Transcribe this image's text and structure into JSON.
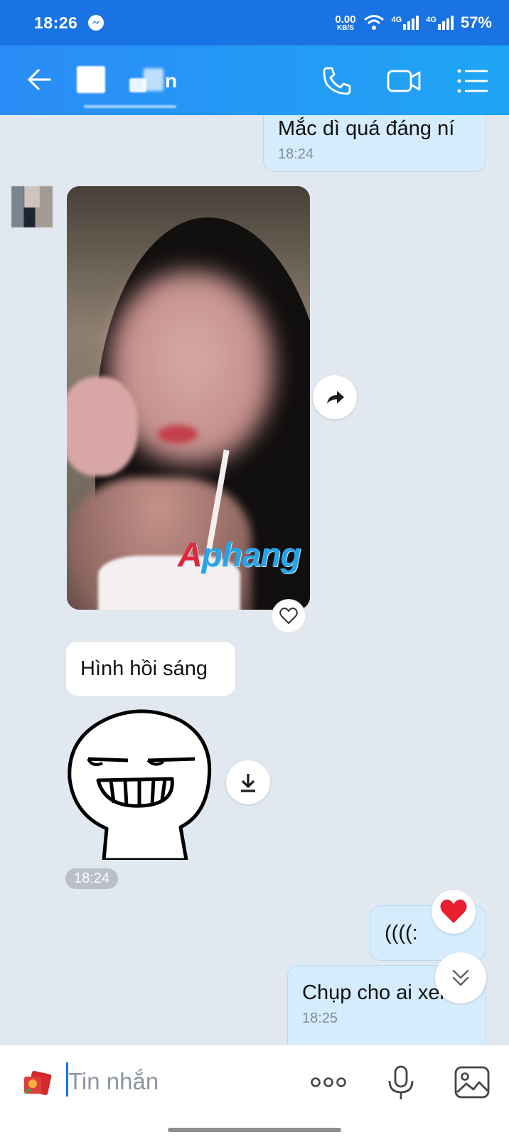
{
  "status_bar": {
    "time": "18:26",
    "net_speed_value": "0.00",
    "net_speed_unit": "KB/S",
    "network1": "4G",
    "network2": "4G",
    "battery": "57%"
  },
  "header": {
    "contact_name_visible": "n",
    "icons": [
      "back-arrow-icon",
      "phone-icon",
      "video-camera-icon",
      "menu-list-icon"
    ]
  },
  "messages": [
    {
      "side": "out",
      "text": "Mắc dì quá đáng ní",
      "time": "18:24"
    },
    {
      "side": "in",
      "type": "photo",
      "watermark_prefix": "A",
      "watermark": "phang"
    },
    {
      "side": "in",
      "text": "Hình hồi sáng"
    },
    {
      "side": "in",
      "type": "sticker"
    },
    {
      "side": "in",
      "type": "time-pill",
      "time": "18:24"
    },
    {
      "side": "out",
      "text": "((((:",
      "reaction": "heart"
    },
    {
      "side": "out",
      "text": "Chụp cho ai xem",
      "time": "18:25"
    }
  ],
  "input": {
    "placeholder": "Tin nhắn"
  },
  "colors": {
    "accent": "#1a73e2",
    "outgoing_bubble": "#d5ecfd",
    "incoming_bubble": "#ffffff",
    "background": "#e2e8f0"
  }
}
